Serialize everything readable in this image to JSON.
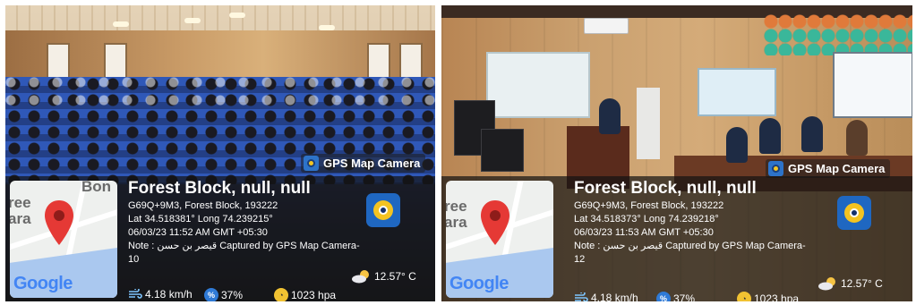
{
  "panels": [
    {
      "id": "left",
      "tag": "GPS Map Camera",
      "map_labels": [
        "Bon",
        "ree",
        "ara"
      ],
      "map_brand": "Google",
      "title": "Forest Block, null, null",
      "plus_code": "G69Q+9M3, Forest Block, 193222",
      "coords": "Lat 34.518381° Long 74.239215°",
      "datetime": "06/03/23 11:52 AM GMT +05:30",
      "note": "Note : قيصر بن حسن Captured by GPS Map Camera-",
      "note_cont": "10",
      "temperature": "12.57° C",
      "wind": "4.18 km/h",
      "humidity": "37%",
      "pressure": "1023 hpa"
    },
    {
      "id": "right",
      "tag": "GPS Map Camera",
      "map_labels": [
        "ree",
        "ara"
      ],
      "map_brand": "Google",
      "title": "Forest Block, null, null",
      "plus_code": "G69Q+9M3, Forest Block, 193222",
      "coords": "Lat 34.518373° Long 74.239218°",
      "datetime": "06/03/23 11:53 AM GMT +05:30",
      "note": "Note : قيصر بن حسن Captured by GPS Map Camera-",
      "note_cont": "12",
      "temperature": "12.57° C",
      "wind": "4.18 km/h",
      "humidity": "37%",
      "pressure": "1023 hpa"
    }
  ],
  "icons": {
    "pin": "map-pin-icon",
    "wind": "wind-icon",
    "humidity": "humidity-icon",
    "pressure": "pressure-gauge-icon",
    "weather": "cloud-sun-icon",
    "app": "gps-map-camera-app-icon"
  },
  "colors": {
    "pin_red": "#e53935",
    "overlay": "#121212",
    "app_blue": "#1f67c1",
    "app_yellow": "#f4c321"
  }
}
